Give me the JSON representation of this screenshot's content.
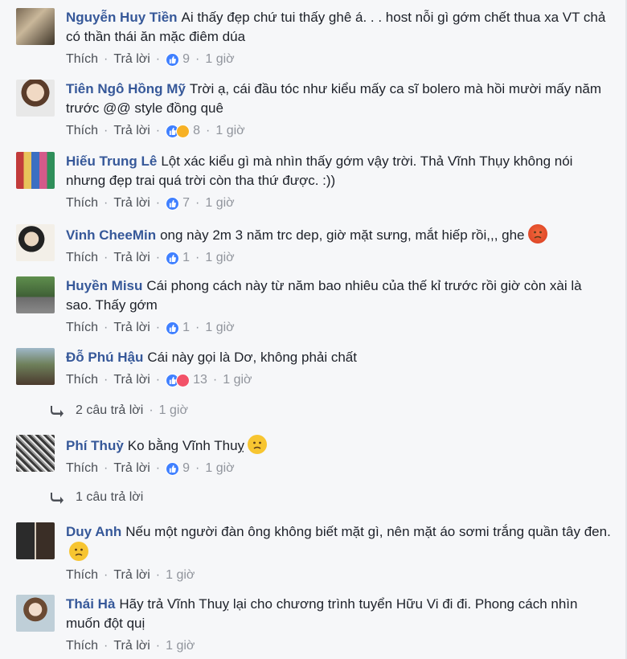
{
  "ui": {
    "like_label": "Thích",
    "reply_label": "Trả lời"
  },
  "comments": [
    {
      "author": "Nguyễn Huy Tiền",
      "text": "Ai thấy đẹp chứ tui thấy ghê á. . . host nỗi gì gớm chết thua xa VT chả có thần thái ăn mặc điêm dúa",
      "reaction_count": "9",
      "time": "1 giờ",
      "reactions": [
        "like"
      ]
    },
    {
      "author": "Tiên Ngô Hồng Mỹ",
      "text": "Trời ạ, cái đầu tóc như kiểu mấy ca sĩ bolero mà hồi mười mấy năm trước @@ style đồng quê",
      "reaction_count": "8",
      "time": "1 giờ",
      "reactions": [
        "like",
        "haha"
      ]
    },
    {
      "author": "Hiếu Trung Lê",
      "text": "Lột xác kiểu gì mà nhìn thấy gớm vậy trời. Thả Vĩnh Thụy không nói nhưng đẹp trai quá trời còn tha thứ được. :))",
      "reaction_count": "7",
      "time": "1 giờ",
      "reactions": [
        "like"
      ]
    },
    {
      "author": "Vinh CheeMin",
      "text": "ong này 2m 3 năm trc dep, giờ mặt sưng, mắt hiếp rồi,,, ghe",
      "emoji": "angry-face-icon",
      "reaction_count": "1",
      "time": "1 giờ",
      "reactions": [
        "like"
      ]
    },
    {
      "author": "Huyền Misu",
      "text": "Cái phong cách này từ năm bao nhiêu của thế kỉ trước rồi giờ còn xài là sao. Thấy gớm",
      "reaction_count": "1",
      "time": "1 giờ",
      "reactions": [
        "like"
      ]
    },
    {
      "author": "Đỗ Phú Hậu",
      "text": "Cái này gọi là Dơ, không phải chất",
      "reaction_count": "13",
      "time": "1 giờ",
      "reactions": [
        "like",
        "love"
      ],
      "replies": "2 câu trả lời",
      "replies_time": "1 giờ"
    },
    {
      "author": "Phí Thuỳ",
      "text": "Ko bằng Vĩnh Thuỵ",
      "emoji": "disappointed-face-icon",
      "reaction_count": "9",
      "time": "1 giờ",
      "reactions": [
        "like"
      ],
      "replies": "1 câu trả lời"
    },
    {
      "author": "Duy Anh",
      "text": "Nếu một người đàn ông không biết mặt gì, nên mặt áo sơmi trắng quần tây đen.",
      "emoji": "unamused-face-icon",
      "time": "1 giờ",
      "reactions": []
    },
    {
      "author": "Thái Hà",
      "text": "Hãy trả Vĩnh Thuỵ lại cho chương trình tuyển Hữu Vi đi đi. Phong cách nhìn muốn đột quị",
      "time": "1 giờ",
      "reactions": []
    }
  ]
}
